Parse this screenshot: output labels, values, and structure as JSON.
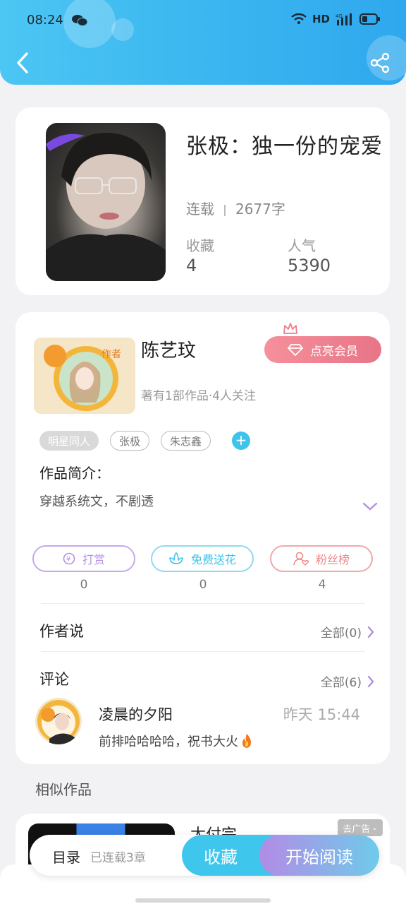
{
  "status_bar": {
    "time": "08:24",
    "network": "HD",
    "signal_label": "4G"
  },
  "icons": {
    "back": "chevron-left-icon",
    "share": "share-icon",
    "crown": "crown-icon",
    "diamond": "diamond-icon",
    "coin": "coin-icon",
    "flower": "flower-icon",
    "fan": "person-heart-icon",
    "chevron": "chevron-right-icon",
    "expand": "chevron-down-icon",
    "fire": "fire-icon"
  },
  "book": {
    "title": "张极：独一份的宠爱",
    "status": "连载",
    "word_count": "2677字",
    "favorites_label": "收藏",
    "favorites_value": "4",
    "popularity_label": "人气",
    "popularity_value": "5390"
  },
  "author": {
    "name": "陈艺玟",
    "badge": "作者",
    "meta": "著有1部作品·4人关注",
    "vip_button": "点亮会员",
    "tags": [
      "明星同人",
      "张极",
      "朱志鑫"
    ],
    "intro_label": "作品简介：",
    "intro_text": "穿越系统文，不剧透"
  },
  "actions": [
    {
      "label": "打赏",
      "count": "0"
    },
    {
      "label": "免费送花",
      "count": "0"
    },
    {
      "label": "粉丝榜",
      "count": "4"
    }
  ],
  "author_says": {
    "label": "作者说",
    "link": "全部(0)"
  },
  "comments": {
    "label": "评论",
    "link": "全部(6)",
    "items": [
      {
        "user": "凌晨的夕阳",
        "time": "昨天 15:44",
        "text": "前排哈哈哈哈，祝书大火"
      }
    ]
  },
  "similar": {
    "title": "相似作品",
    "first_name": "太付完",
    "ad_label": "去广告"
  },
  "bottom_bar": {
    "toc": "目录",
    "chapters": "已连载3章",
    "favorite": "收藏",
    "read": "开始阅读"
  },
  "colors": {
    "header": "#3db8f0",
    "vip": "#ec7f90",
    "tip": "#b391e0",
    "flower": "#4cc6ea",
    "fans": "#ec8a8a",
    "read_btn": "#b38be6"
  }
}
